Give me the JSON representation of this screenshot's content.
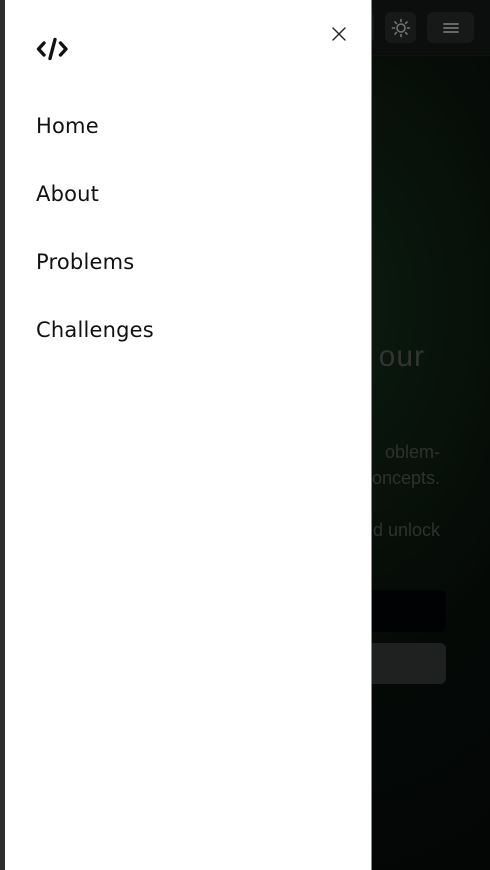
{
  "drawer": {
    "logo_icon": "code-brackets-icon",
    "close_icon": "close-icon",
    "nav_items": [
      {
        "label": "Home"
      },
      {
        "label": "About"
      },
      {
        "label": "Problems"
      },
      {
        "label": "Challenges"
      }
    ]
  },
  "background": {
    "header": {
      "theme_icon": "sun-icon",
      "menu_icon": "hamburger-icon"
    },
    "hero": {
      "title_fragment": "our",
      "line1_fragment": "oblem-",
      "line2_fragment": "oncepts.",
      "line3_fragment": "d unlock"
    }
  },
  "colors": {
    "drawer_bg": "#ffffff",
    "text": "#111111",
    "background_dark": "#0b0f0c",
    "header_button": "#2a2c2c"
  }
}
